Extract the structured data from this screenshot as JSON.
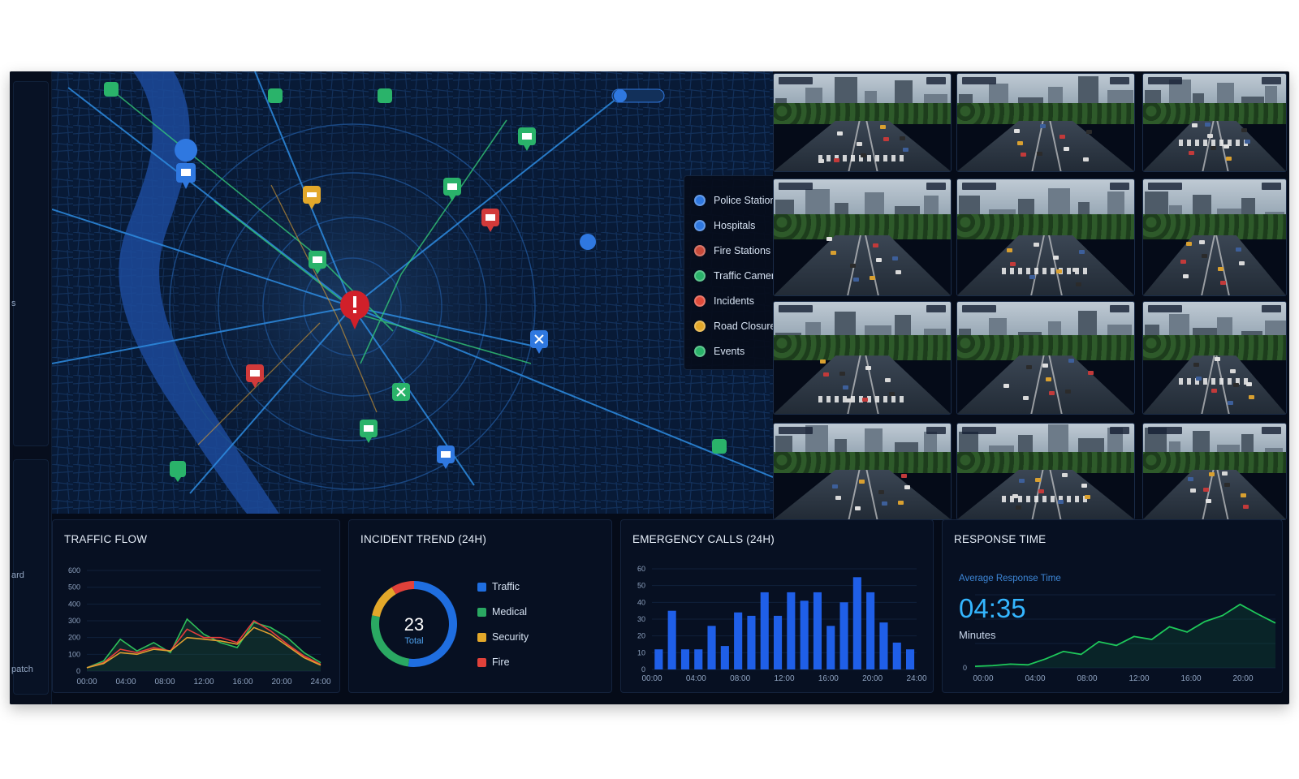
{
  "sidebar": {
    "labels": [
      "s",
      "ard",
      "patch"
    ]
  },
  "map": {
    "legend": [
      {
        "label": "Police Stations",
        "color": "#2f78e0"
      },
      {
        "label": "Hospitals",
        "color": "#2f78e0"
      },
      {
        "label": "Fire Stations",
        "color": "#c74a3a"
      },
      {
        "label": "Traffic Cameras",
        "color": "#2ab36a"
      },
      {
        "label": "Incidents",
        "color": "#e04b3a"
      },
      {
        "label": "Road Closures",
        "color": "#e3a82a"
      },
      {
        "label": "Events",
        "color": "#2ab36a"
      }
    ]
  },
  "cameras": {
    "count": 12
  },
  "traffic_flow": {
    "title": "TRAFFIC FLOW",
    "chart_data": {
      "type": "line",
      "x": [
        "00:00",
        "04:00",
        "08:00",
        "12:00",
        "16:00",
        "20:00",
        "24:00"
      ],
      "yticks": [
        "0",
        "100",
        "200",
        "300",
        "400",
        "500",
        "600"
      ],
      "ylim": [
        0,
        600
      ],
      "series": [
        {
          "color": "#2fbf5a",
          "values": [
            20,
            60,
            190,
            120,
            170,
            110,
            310,
            220,
            170,
            140,
            290,
            260,
            200,
            110,
            50
          ]
        },
        {
          "color": "#e83c3c",
          "values": [
            20,
            50,
            130,
            110,
            140,
            120,
            250,
            200,
            200,
            170,
            300,
            240,
            160,
            90,
            40
          ]
        },
        {
          "color": "#e0a030",
          "values": [
            20,
            45,
            110,
            100,
            130,
            120,
            200,
            190,
            180,
            160,
            260,
            220,
            150,
            80,
            35
          ]
        }
      ]
    }
  },
  "incident_trend": {
    "title": "INCIDENT TREND (24H)",
    "total_value": "23",
    "total_label": "Total",
    "chart_data": {
      "type": "pie",
      "categories": [
        "Traffic",
        "Medical",
        "Security",
        "Fire"
      ],
      "values": [
        12,
        6,
        3,
        2
      ],
      "labels": [
        "12 (52%)",
        "6 (26%)",
        "3 (13%)",
        "2 (13%)"
      ],
      "colors": [
        "#1f6ee0",
        "#2aa862",
        "#e3a82a",
        "#e0413a"
      ]
    }
  },
  "emergency_calls": {
    "title": "EMERGENCY CALLS (24H)",
    "chart_data": {
      "type": "bar",
      "x_ticks": [
        "00:00",
        "04:00",
        "08:00",
        "12:00",
        "16:00",
        "20:00",
        "24:00"
      ],
      "yticks": [
        "0",
        "10",
        "20",
        "30",
        "40",
        "50",
        "60"
      ],
      "ylim": [
        0,
        60
      ],
      "values": [
        12,
        35,
        12,
        12,
        26,
        14,
        34,
        32,
        46,
        32,
        46,
        41,
        46,
        26,
        40,
        55,
        46,
        28,
        16,
        12
      ],
      "color": "#1f5fe8"
    }
  },
  "response_time": {
    "title": "RESPONSE TIME",
    "subtitle": "Average Response Time",
    "value": "04:35",
    "unit": "Minutes",
    "chart_data": {
      "type": "line",
      "x": [
        "00:00",
        "04:00",
        "08:00",
        "12:00",
        "16:00",
        "20:00"
      ],
      "yticks": [
        "0"
      ],
      "values": [
        0.02,
        0.03,
        0.05,
        0.04,
        0.12,
        0.22,
        0.18,
        0.35,
        0.3,
        0.42,
        0.38,
        0.55,
        0.48,
        0.62,
        0.7,
        0.85,
        0.72,
        0.6
      ],
      "color": "#1ec85a"
    }
  }
}
